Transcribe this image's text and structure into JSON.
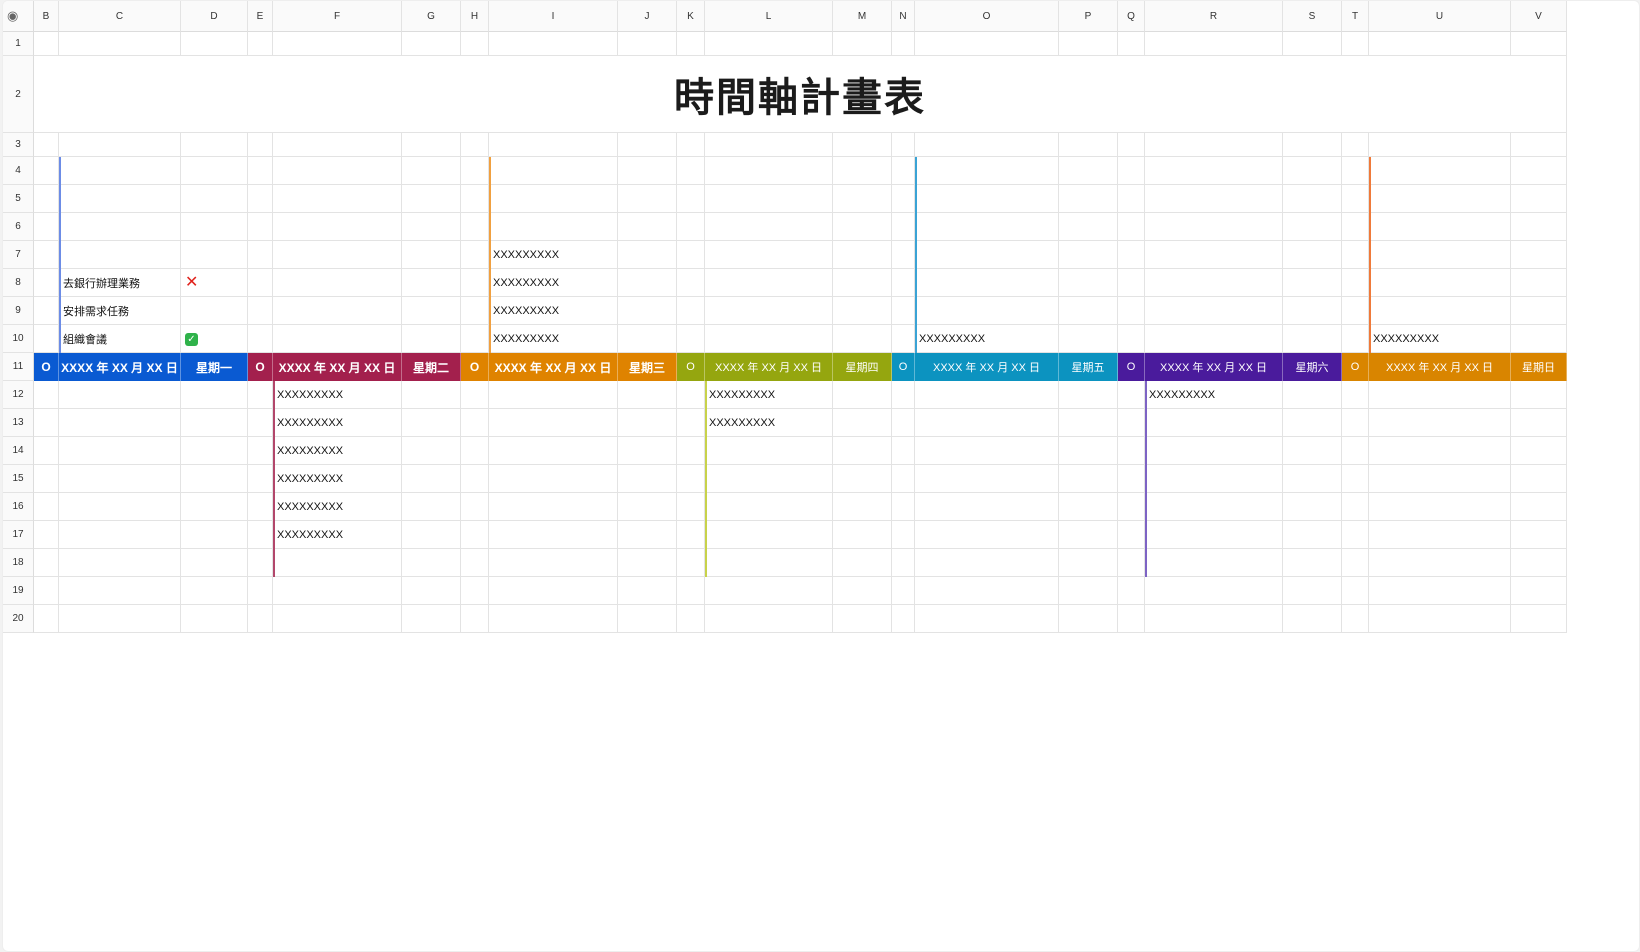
{
  "columns": [
    "B",
    "C",
    "D",
    "E",
    "F",
    "G",
    "H",
    "I",
    "J",
    "K",
    "L",
    "M",
    "N",
    "O",
    "P",
    "Q",
    "R",
    "S",
    "T",
    "U",
    "V"
  ],
  "rows": [
    "1",
    "2",
    "3",
    "4",
    "5",
    "6",
    "7",
    "8",
    "9",
    "10",
    "11",
    "12",
    "13",
    "14",
    "15",
    "16",
    "17",
    "18",
    "19",
    "20"
  ],
  "title": "時間軸計畫表",
  "tasks": [
    {
      "label": "去銀行辦理業務",
      "status_icon": "cross-mark-icon"
    },
    {
      "label": "安排需求任務",
      "status_icon": ""
    },
    {
      "label": "組織會議",
      "status_icon": "check-mark-icon"
    }
  ],
  "placeholder_text": "XXXXXXXXX",
  "day_headers": [
    {
      "marker": "O",
      "date": "XXXX 年 XX 月 XX 日",
      "weekday": "星期一",
      "color": "#0a5ad2"
    },
    {
      "marker": "O",
      "date": "XXXX 年 XX 月 XX 日",
      "weekday": "星期二",
      "color": "#a3204d"
    },
    {
      "marker": "O",
      "date": "XXXX 年 XX 月 XX 日",
      "weekday": "星期三",
      "color": "#df8300"
    },
    {
      "marker": "O",
      "date": "XXXX 年 XX 月 XX 日",
      "weekday": "星期四",
      "color": "#95a60f"
    },
    {
      "marker": "O",
      "date": "XXXX 年 XX 月 XX 日",
      "weekday": "星期五",
      "color": "#0c93c0"
    },
    {
      "marker": "O",
      "date": "XXXX 年 XX 月 XX 日",
      "weekday": "星期六",
      "color": "#4a1b9c"
    },
    {
      "marker": "O",
      "date": "XXXX 年 XX 月 XX 日",
      "weekday": "星期日",
      "color": "#d98500"
    }
  ],
  "line_colors": {
    "mon": "#6c8ce6",
    "tue": "#b2476b",
    "wed": "#f0a040",
    "thu": "#c8d24a",
    "fri": "#3aa3d5",
    "sat": "#7d63c4",
    "sun": "#ef7a3a"
  },
  "toolbar_icon": "eye-icon"
}
